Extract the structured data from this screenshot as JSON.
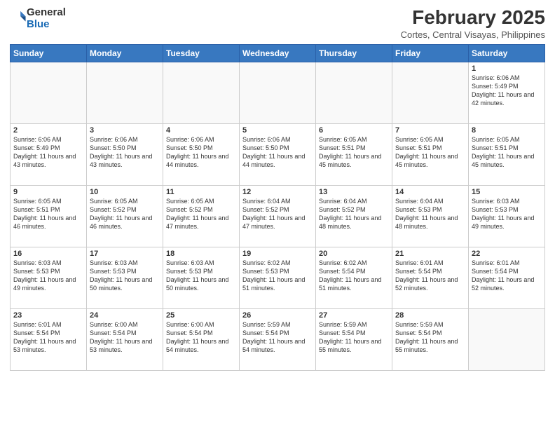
{
  "header": {
    "logo_general": "General",
    "logo_blue": "Blue",
    "month": "February 2025",
    "location": "Cortes, Central Visayas, Philippines"
  },
  "weekdays": [
    "Sunday",
    "Monday",
    "Tuesday",
    "Wednesday",
    "Thursday",
    "Friday",
    "Saturday"
  ],
  "weeks": [
    [
      {
        "day": "",
        "empty": true
      },
      {
        "day": "",
        "empty": true
      },
      {
        "day": "",
        "empty": true
      },
      {
        "day": "",
        "empty": true
      },
      {
        "day": "",
        "empty": true
      },
      {
        "day": "",
        "empty": true
      },
      {
        "day": "1",
        "sunrise": "6:06 AM",
        "sunset": "5:49 PM",
        "daylight": "11 hours and 42 minutes."
      }
    ],
    [
      {
        "day": "2",
        "sunrise": "6:06 AM",
        "sunset": "5:49 PM",
        "daylight": "11 hours and 43 minutes."
      },
      {
        "day": "3",
        "sunrise": "6:06 AM",
        "sunset": "5:50 PM",
        "daylight": "11 hours and 43 minutes."
      },
      {
        "day": "4",
        "sunrise": "6:06 AM",
        "sunset": "5:50 PM",
        "daylight": "11 hours and 44 minutes."
      },
      {
        "day": "5",
        "sunrise": "6:06 AM",
        "sunset": "5:50 PM",
        "daylight": "11 hours and 44 minutes."
      },
      {
        "day": "6",
        "sunrise": "6:05 AM",
        "sunset": "5:51 PM",
        "daylight": "11 hours and 45 minutes."
      },
      {
        "day": "7",
        "sunrise": "6:05 AM",
        "sunset": "5:51 PM",
        "daylight": "11 hours and 45 minutes."
      },
      {
        "day": "8",
        "sunrise": "6:05 AM",
        "sunset": "5:51 PM",
        "daylight": "11 hours and 45 minutes."
      }
    ],
    [
      {
        "day": "9",
        "sunrise": "6:05 AM",
        "sunset": "5:51 PM",
        "daylight": "11 hours and 46 minutes."
      },
      {
        "day": "10",
        "sunrise": "6:05 AM",
        "sunset": "5:52 PM",
        "daylight": "11 hours and 46 minutes."
      },
      {
        "day": "11",
        "sunrise": "6:05 AM",
        "sunset": "5:52 PM",
        "daylight": "11 hours and 47 minutes."
      },
      {
        "day": "12",
        "sunrise": "6:04 AM",
        "sunset": "5:52 PM",
        "daylight": "11 hours and 47 minutes."
      },
      {
        "day": "13",
        "sunrise": "6:04 AM",
        "sunset": "5:52 PM",
        "daylight": "11 hours and 48 minutes."
      },
      {
        "day": "14",
        "sunrise": "6:04 AM",
        "sunset": "5:53 PM",
        "daylight": "11 hours and 48 minutes."
      },
      {
        "day": "15",
        "sunrise": "6:03 AM",
        "sunset": "5:53 PM",
        "daylight": "11 hours and 49 minutes."
      }
    ],
    [
      {
        "day": "16",
        "sunrise": "6:03 AM",
        "sunset": "5:53 PM",
        "daylight": "11 hours and 49 minutes."
      },
      {
        "day": "17",
        "sunrise": "6:03 AM",
        "sunset": "5:53 PM",
        "daylight": "11 hours and 50 minutes."
      },
      {
        "day": "18",
        "sunrise": "6:03 AM",
        "sunset": "5:53 PM",
        "daylight": "11 hours and 50 minutes."
      },
      {
        "day": "19",
        "sunrise": "6:02 AM",
        "sunset": "5:53 PM",
        "daylight": "11 hours and 51 minutes."
      },
      {
        "day": "20",
        "sunrise": "6:02 AM",
        "sunset": "5:54 PM",
        "daylight": "11 hours and 51 minutes."
      },
      {
        "day": "21",
        "sunrise": "6:01 AM",
        "sunset": "5:54 PM",
        "daylight": "11 hours and 52 minutes."
      },
      {
        "day": "22",
        "sunrise": "6:01 AM",
        "sunset": "5:54 PM",
        "daylight": "11 hours and 52 minutes."
      }
    ],
    [
      {
        "day": "23",
        "sunrise": "6:01 AM",
        "sunset": "5:54 PM",
        "daylight": "11 hours and 53 minutes."
      },
      {
        "day": "24",
        "sunrise": "6:00 AM",
        "sunset": "5:54 PM",
        "daylight": "11 hours and 53 minutes."
      },
      {
        "day": "25",
        "sunrise": "6:00 AM",
        "sunset": "5:54 PM",
        "daylight": "11 hours and 54 minutes."
      },
      {
        "day": "26",
        "sunrise": "5:59 AM",
        "sunset": "5:54 PM",
        "daylight": "11 hours and 54 minutes."
      },
      {
        "day": "27",
        "sunrise": "5:59 AM",
        "sunset": "5:54 PM",
        "daylight": "11 hours and 55 minutes."
      },
      {
        "day": "28",
        "sunrise": "5:59 AM",
        "sunset": "5:54 PM",
        "daylight": "11 hours and 55 minutes."
      },
      {
        "day": "",
        "empty": true
      }
    ]
  ]
}
